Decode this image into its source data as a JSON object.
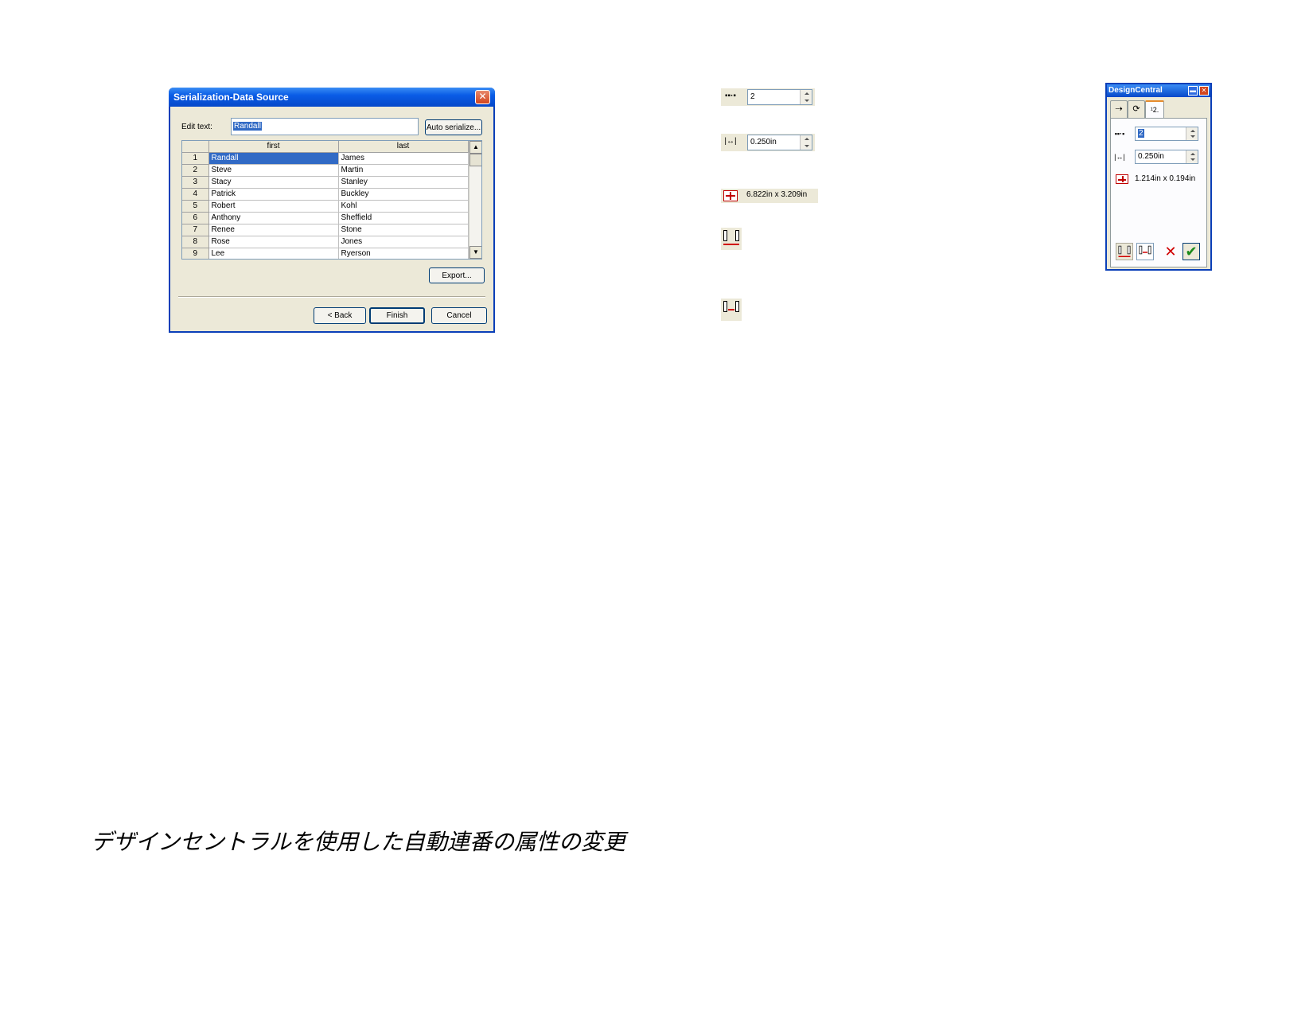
{
  "dialog": {
    "title": "Serialization-Data Source",
    "edit_text_label": "Edit text:",
    "edit_text_value": "Randall",
    "auto_serialize_label": "Auto serialize...",
    "columns": [
      "first",
      "last"
    ],
    "rows": [
      {
        "n": "1",
        "first": "Randall",
        "last": "James"
      },
      {
        "n": "2",
        "first": "Steve",
        "last": "Martin"
      },
      {
        "n": "3",
        "first": "Stacy",
        "last": "Stanley"
      },
      {
        "n": "4",
        "first": "Patrick",
        "last": "Buckley"
      },
      {
        "n": "5",
        "first": "Robert",
        "last": "Kohl"
      },
      {
        "n": "6",
        "first": "Anthony",
        "last": "Sheffield"
      },
      {
        "n": "7",
        "first": "Renee",
        "last": "Stone"
      },
      {
        "n": "8",
        "first": "Rose",
        "last": "Jones"
      },
      {
        "n": "9",
        "first": "Lee",
        "last": "Ryerson"
      }
    ],
    "export_label": "Export...",
    "back_label": "< Back",
    "finish_label": "Finish",
    "cancel_label": "Cancel"
  },
  "toolbar": {
    "count_value": "2",
    "spacing_value": "0.250in",
    "size_readout": "6.822in x 3.209in"
  },
  "design_central": {
    "title": "DesignCentral",
    "tabs": [
      "move-tab",
      "rotate-tab",
      "serialize-tab"
    ],
    "count_value": "2",
    "spacing_value": "0.250in",
    "size_readout": "1.214in x 0.194in"
  },
  "caption": "デザインセントラルを使用した自動連番の属性の変更"
}
